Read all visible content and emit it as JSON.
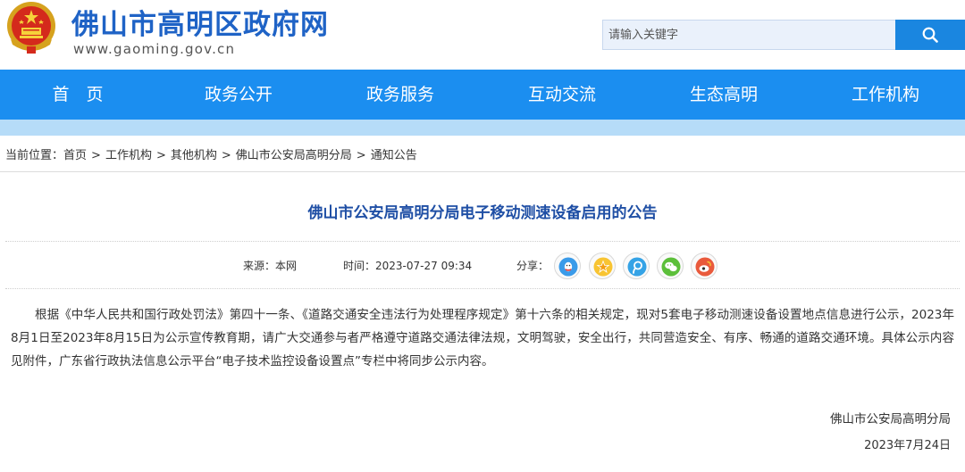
{
  "header": {
    "site_title": "佛山市高明区政府网",
    "site_url": "www.gaoming.gov.cn",
    "search_placeholder": "请输入关键字"
  },
  "nav": {
    "items": [
      "首　页",
      "政务公开",
      "政务服务",
      "互动交流",
      "生态高明",
      "工作机构"
    ]
  },
  "breadcrumb": {
    "prefix": "当前位置：",
    "items": [
      "首页",
      "工作机构",
      "其他机构",
      "佛山市公安局高明分局",
      "通知公告"
    ],
    "separator": ">"
  },
  "article": {
    "title": "佛山市公安局高明分局电子移动测速设备启用的公告",
    "source_label": "来源：",
    "source": "本网",
    "time_label": "时间：",
    "time": "2023-07-27 09:34",
    "share_label": "分享：",
    "share_icons": [
      "qq-icon",
      "qzone-icon",
      "tencent-weibo-icon",
      "wechat-icon",
      "sina-weibo-icon"
    ],
    "body": "根据《中华人民共和国行政处罚法》第四十一条、《道路交通安全违法行为处理程序规定》第十六条的相关规定，现对5套电子移动测速设备设置地点信息进行公示，2023年8月1日至2023年8月15日为公示宣传教育期，请广大交通参与者严格遵守道路交通法律法规，文明驾驶，安全出行，共同营造安全、有序、畅通的道路交通环境。具体公示内容见附件，广东省行政执法信息公示平台“电子技术监控设备设置点”专栏中将同步公示内容。",
    "signer": "佛山市公安局高明分局",
    "sign_date": "2023年7月24日"
  },
  "colors": {
    "brand_blue": "#1f63c6",
    "nav_blue": "#1b8ef0",
    "nav_sub": "#b6dcf8",
    "title_blue": "#1f4fa5",
    "search_btn": "#1a86e0"
  }
}
